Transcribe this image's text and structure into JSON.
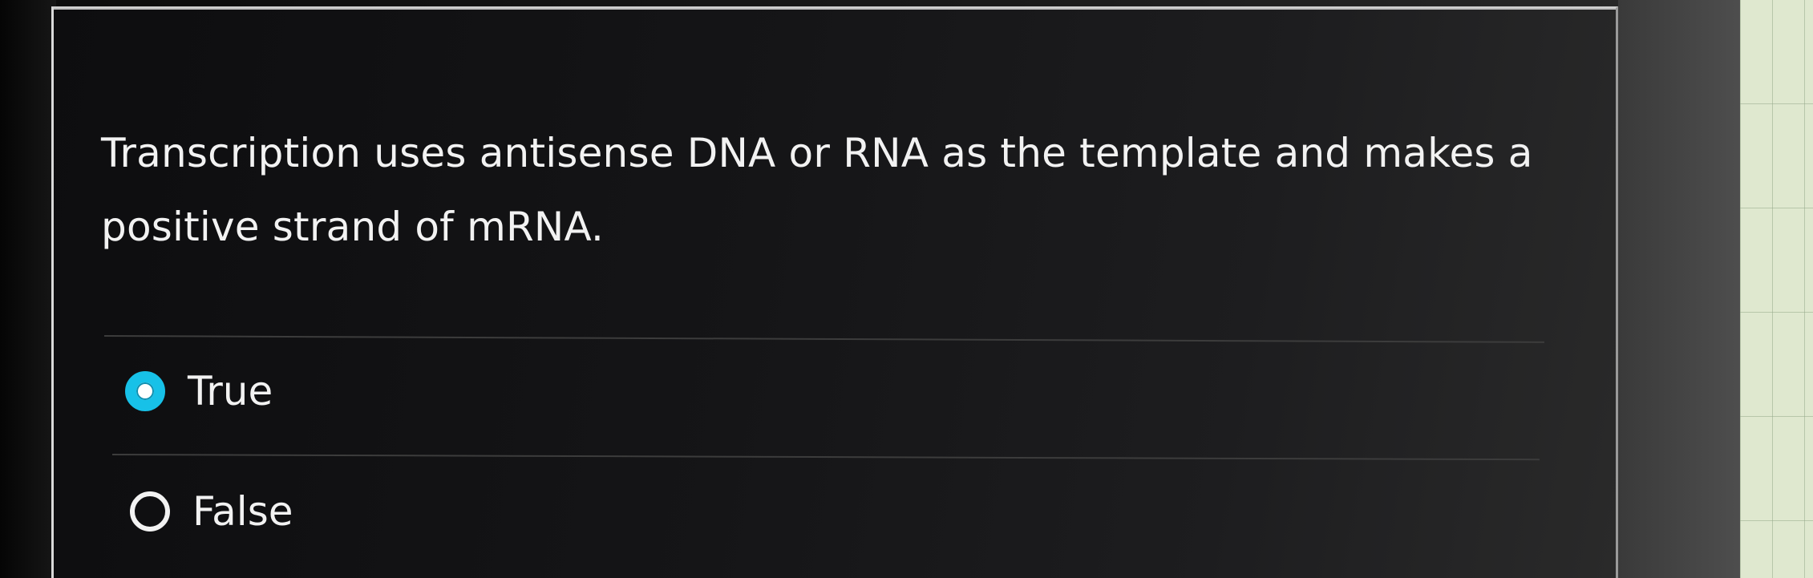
{
  "quiz": {
    "question_text": "Transcription uses antisense DNA or RNA as the template and makes a positive strand of mRNA.",
    "options": [
      {
        "label": "True",
        "selected": true
      },
      {
        "label": "False",
        "selected": false
      }
    ]
  },
  "colors": {
    "panel_background": "#141416",
    "text": "#f2f2f2",
    "radio_selected_accent": "#17c1e8",
    "divider": "#3c3c3c"
  },
  "icons": {
    "selected": "radio-checked-icon",
    "unselected": "radio-unchecked-icon"
  }
}
